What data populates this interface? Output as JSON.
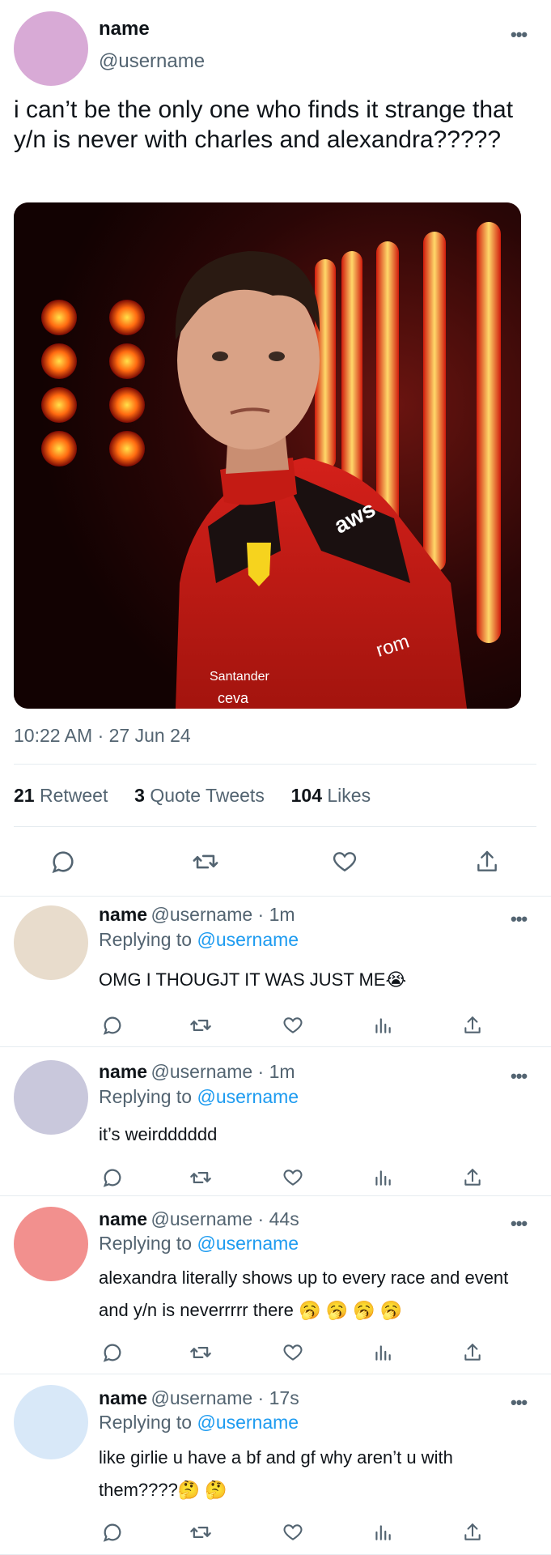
{
  "main_tweet": {
    "name": "name",
    "handle": "@username",
    "text": "i can’t be the only one who finds it strange that y/n is never with charles and alexandra?????",
    "timestamp": "10:22 AM · 27 Jun 24",
    "avatar_color": "#d8aad6",
    "photo_text": {
      "sponsor_1": "aws",
      "sponsor_2": "Santander",
      "sponsor_3": "ceva",
      "sponsor_4": "rom"
    },
    "stats": {
      "retweets_count": "21",
      "retweets_label": "Retweet",
      "quotes_count": "3",
      "quotes_label": "Quote Tweets",
      "likes_count": "104",
      "likes_label": "Likes"
    }
  },
  "replies": [
    {
      "name": "name",
      "meta": "@username · 1m",
      "replying_prefix": "Replying to ",
      "replying_handle": "@username",
      "text": "OMG I THOUGJT IT WAS JUST ME😭",
      "avatar_color": "#e8dccc"
    },
    {
      "name": "name",
      "meta": "@username · 1m",
      "replying_prefix": "Replying to ",
      "replying_handle": "@username",
      "text": "it’s weirdddddd",
      "avatar_color": "#c9c8dc"
    },
    {
      "name": "name",
      "meta": "@username · 44s",
      "replying_prefix": "Replying to ",
      "replying_handle": "@username",
      "text": "alexandra literally shows up to every race and event and y/n is neverrrrr there 🥱 🥱 🥱 🥱",
      "avatar_color": "#f2908e"
    },
    {
      "name": "name",
      "meta": "@username · 17s",
      "replying_prefix": "Replying to ",
      "replying_handle": "@username",
      "text": "like girlie u have a bf and gf why aren’t u with them????🤔 🤔",
      "avatar_color": "#d8e8f8"
    }
  ],
  "colors": {
    "link": "#1d9bf0",
    "muted": "#536471",
    "divider": "#e6ecf0"
  }
}
